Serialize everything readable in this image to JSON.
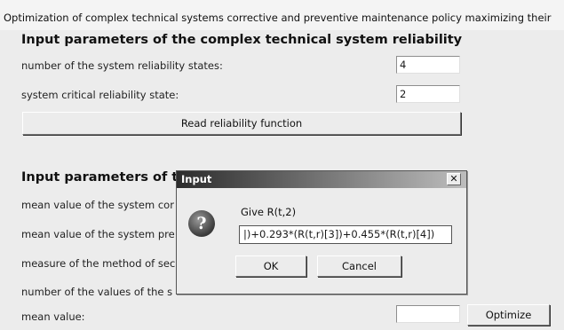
{
  "window_title": "Optimization of complex technical systems corrective and preventive maintenance policy maximizing their",
  "section1": {
    "heading": "Input parameters of the complex technical system reliability",
    "states_label": "number of the system reliability states:",
    "states_value": "4",
    "critical_label": "system critical reliability state:",
    "critical_value": "2",
    "read_button": "Read reliability function"
  },
  "section2": {
    "heading": "Input parameters of th",
    "row1": "mean value of the system cor",
    "row2": "mean value of the system pre",
    "row3": "measure of the method of sec",
    "row4": "number of the values of the s",
    "mean_label": "mean value:",
    "mean_value": "",
    "optimize_button": "Optimize"
  },
  "dialog": {
    "title": "Input",
    "close_glyph": "✕",
    "icon_glyph": "?",
    "prompt": "Give R(t,2)",
    "input_value": "|)+0.293*(R(t,r)[3])+0.455*(R(t,r)[4])",
    "ok_button": "OK",
    "cancel_button": "Cancel"
  }
}
